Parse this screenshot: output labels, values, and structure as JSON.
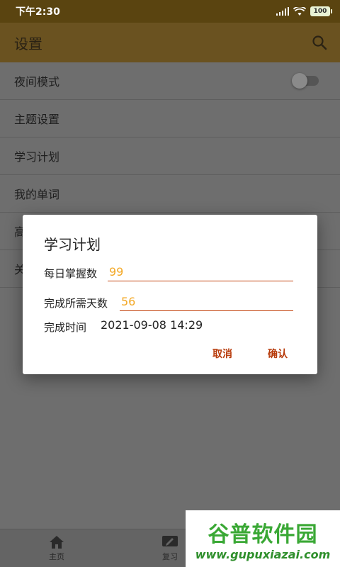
{
  "status_bar": {
    "time": "下午2:30",
    "battery": "100"
  },
  "app_bar": {
    "title": "设置",
    "search_icon": "search-icon"
  },
  "settings_list": [
    {
      "label": "夜间模式",
      "has_toggle": true,
      "toggle_on": false
    },
    {
      "label": "主题设置"
    },
    {
      "label": "学习计划"
    },
    {
      "label": "我的单词"
    },
    {
      "label": "高"
    },
    {
      "label": "关"
    }
  ],
  "bottom_nav": [
    {
      "label": "主页",
      "icon": "home-icon"
    },
    {
      "label": "复习",
      "icon": "edit-icon"
    }
  ],
  "dialog": {
    "title": "学习计划",
    "daily_label": "每日掌握数",
    "daily_value": "99",
    "days_label": "完成所需天数",
    "days_value": "56",
    "finish_label": "完成时间",
    "finish_value": "2021-09-08 14:29",
    "cancel_label": "取消",
    "confirm_label": "确认"
  },
  "watermark": {
    "name": "谷普软件园",
    "url": "www.gupuxiazai.com"
  },
  "colors": {
    "accent": "#b73a0a",
    "input_value": "#f3a825",
    "app_bar": "#6a5220"
  }
}
